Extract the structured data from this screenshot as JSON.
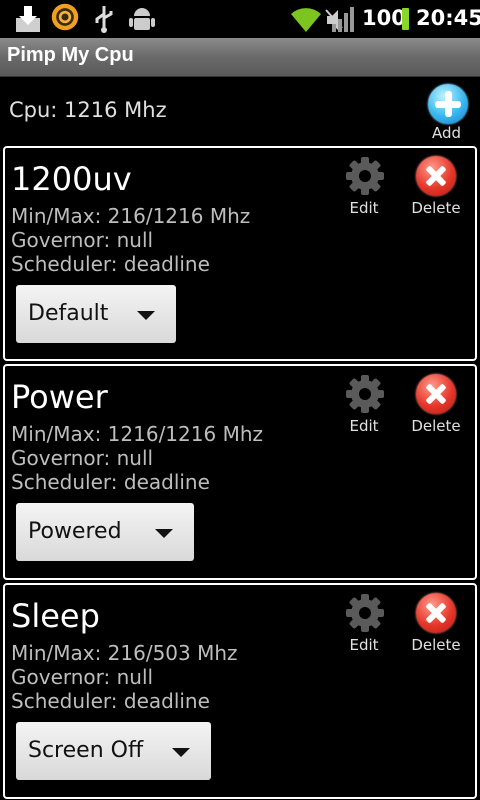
{
  "status_bar": {
    "battery": "100",
    "time": "20:45",
    "icons": [
      "download-icon",
      "sun-app-icon",
      "usb-icon",
      "android-debug-icon",
      "wifi-icon",
      "mute-icon",
      "signal-icon",
      "battery-icon"
    ]
  },
  "app": {
    "title": "Pimp My Cpu"
  },
  "header": {
    "cpu_text": "Cpu: 1216 Mhz",
    "add_label": "Add"
  },
  "colors": {
    "accent_blue": "#39b6ef",
    "delete_red": "#e5372a",
    "battery_green": "#8ad62a"
  },
  "profiles": [
    {
      "name": "1200uv",
      "minmax": "Min/Max: 216/1216 Mhz",
      "governor": "Governor: null",
      "scheduler": "Scheduler: deadline",
      "selected": "Default",
      "edit_label": "Edit",
      "delete_label": "Delete"
    },
    {
      "name": "Power",
      "minmax": "Min/Max: 1216/1216 Mhz",
      "governor": "Governor: null",
      "scheduler": "Scheduler: deadline",
      "selected": "Powered",
      "edit_label": "Edit",
      "delete_label": "Delete"
    },
    {
      "name": "Sleep",
      "minmax": "Min/Max: 216/503 Mhz",
      "governor": "Governor: null",
      "scheduler": "Scheduler: deadline",
      "selected": "Screen Off",
      "edit_label": "Edit",
      "delete_label": "Delete"
    }
  ]
}
